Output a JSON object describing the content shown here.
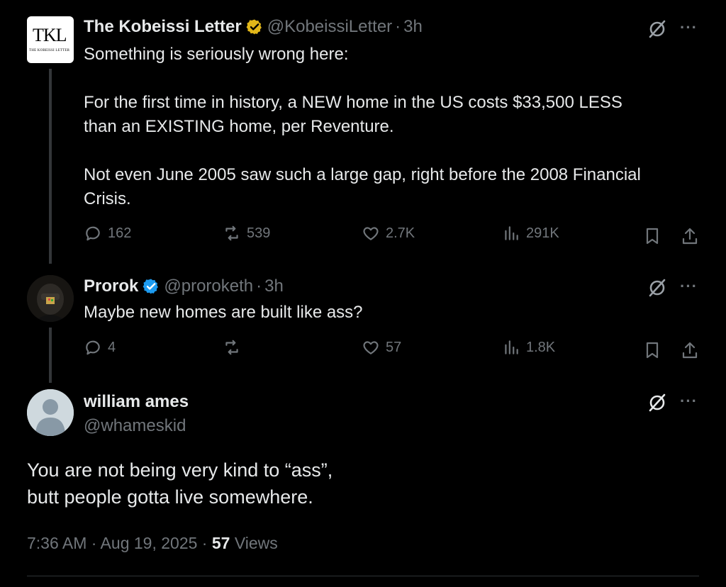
{
  "tweets": [
    {
      "display_name": "The Kobeissi Letter",
      "handle": "@KobeissiLetter",
      "time": "3h",
      "avatar_text": "TKL",
      "avatar_small_text": "THE KOBEISSI LETTER",
      "verified_badge": "gold",
      "text_lines": [
        "Something is seriously wrong here:",
        "For the first time in history, a NEW home in the US costs $33,500 LESS",
        "than an EXISTING home, per Reventure.",
        "Not even June 2005 saw such a large gap, right before the 2008 Financial",
        "Crisis."
      ],
      "replies": "162",
      "reposts": "539",
      "likes": "2.7K",
      "views": "291K"
    },
    {
      "display_name": "Prorok",
      "handle": "@proroketh",
      "time": "3h",
      "verified_badge": "blue",
      "text": "Maybe new homes are built like ass?",
      "replies": "4",
      "reposts": "",
      "likes": "57",
      "views": "1.8K"
    },
    {
      "display_name": "william ames",
      "handle": "@whameskid",
      "text_lines": [
        "You are not being very kind to “ass”,",
        "butt people gotta live somewhere."
      ],
      "time_full": "7:36 AM · Aug 19, 2025 · ",
      "views_count": "57",
      "views_label": "Views"
    }
  ],
  "separator": "·",
  "more_label": "···",
  "colors": {
    "gold_badge": "#e2b719",
    "blue_badge": "#1d9bf0",
    "background": "#000000",
    "muted": "#71767b"
  }
}
